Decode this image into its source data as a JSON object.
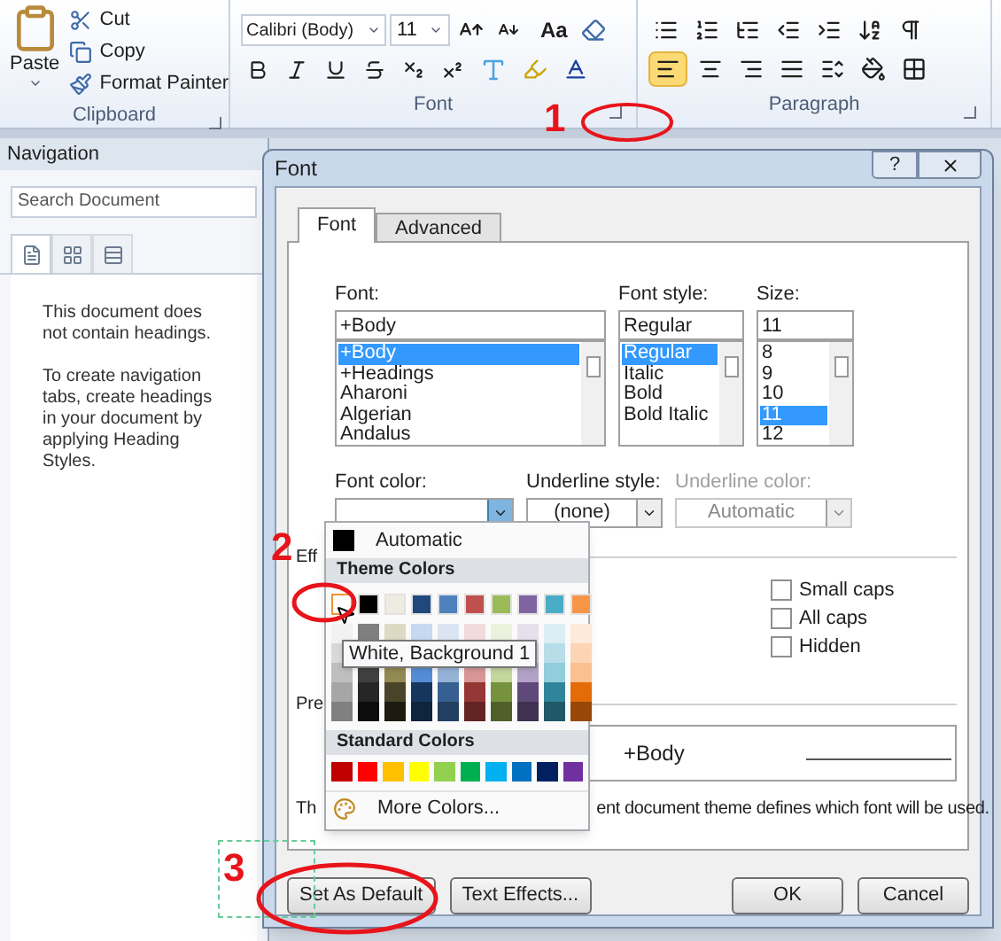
{
  "ribbon": {
    "clipboard": {
      "paste": "Paste",
      "items": [
        {
          "kind": "cut",
          "label": "Cut"
        },
        {
          "kind": "copy",
          "label": "Copy"
        },
        {
          "kind": "painter",
          "label": "Format Painter"
        }
      ],
      "label": "Clipboard"
    },
    "font": {
      "font_name": "Calibri (Body)",
      "font_size": "11",
      "case_label": "Aa",
      "label": "Font"
    },
    "paragraph": {
      "label": "Paragraph",
      "align": [
        {
          "kind": "left",
          "selected": true
        },
        {
          "kind": "center",
          "selected": false
        },
        {
          "kind": "right",
          "selected": false
        },
        {
          "kind": "justify",
          "selected": false
        }
      ]
    }
  },
  "navigation": {
    "title": "Navigation",
    "search": {
      "placeholder": "Search Document"
    },
    "tabs": [
      {
        "kind": "headings",
        "selected": true
      },
      {
        "kind": "pages",
        "selected": false
      },
      {
        "kind": "results",
        "selected": false
      }
    ],
    "messages": [
      "This document does not contain headings.",
      "To create navigation tabs, create headings in your document by applying Heading Styles."
    ]
  },
  "dialog": {
    "title": "Font",
    "help": "?",
    "tabs": [
      {
        "label": "Font",
        "selected": true
      },
      {
        "label": "Advanced",
        "selected": false
      }
    ],
    "font": {
      "label": "Font:",
      "value": "+Body",
      "items": [
        {
          "label": "+Body",
          "selected": true
        },
        {
          "label": "+Headings",
          "selected": false
        },
        {
          "label": "Aharoni",
          "selected": false
        },
        {
          "label": "Algerian",
          "selected": false
        },
        {
          "label": "Andalus",
          "selected": false
        }
      ]
    },
    "style": {
      "label": "Font style:",
      "value": "Regular",
      "items": [
        {
          "label": "Regular",
          "selected": true
        },
        {
          "label": "Italic",
          "selected": false
        },
        {
          "label": "Bold",
          "selected": false
        },
        {
          "label": "Bold Italic",
          "selected": false
        }
      ]
    },
    "size": {
      "label": "Size:",
      "value": "11",
      "items": [
        {
          "label": "8",
          "selected": false
        },
        {
          "label": "9",
          "selected": false
        },
        {
          "label": "10",
          "selected": false
        },
        {
          "label": "11",
          "selected": true
        },
        {
          "label": "12",
          "selected": false
        }
      ]
    },
    "font_color": {
      "label": "Font color:"
    },
    "underline_style": {
      "label": "Underline style:",
      "value": "(none)"
    },
    "underline_color": {
      "label": "Underline color:",
      "value": "Automatic",
      "disabled": true
    },
    "effects_label": "Eff",
    "effects": [
      {
        "label": "Small caps",
        "checked": false
      },
      {
        "label": "All caps",
        "checked": false
      },
      {
        "label": "Hidden",
        "checked": false
      }
    ],
    "preview_label": "Pre",
    "preview_text": "+Body",
    "description_start": "Th",
    "description_end": "ent document theme defines which font will be used.",
    "buttons": [
      {
        "label": "Set As Default"
      },
      {
        "label": "Text Effects..."
      },
      {
        "label": "OK"
      },
      {
        "label": "Cancel"
      }
    ]
  },
  "color_menu": {
    "automatic": "Automatic",
    "theme_header": "Theme Colors",
    "theme": [
      {
        "color": "#ffffff",
        "selected": true,
        "shades": [
          {
            "color": "#f2f2f2"
          },
          {
            "color": "#d9d9d9"
          },
          {
            "color": "#bfbfbf"
          },
          {
            "color": "#a6a6a6"
          },
          {
            "color": "#808080"
          }
        ]
      },
      {
        "color": "#000000",
        "selected": false,
        "shades": [
          {
            "color": "#7f7f7f"
          },
          {
            "color": "#404040"
          },
          {
            "color": "#262626"
          },
          {
            "color": "#0d0d0d"
          }
        ]
      },
      {
        "color": "#eeece1",
        "selected": false,
        "shades": [
          {
            "color": "#ddd9c3"
          },
          {
            "color": "#938953"
          },
          {
            "color": "#494429"
          },
          {
            "color": "#1d1b10"
          }
        ]
      },
      {
        "color": "#1f497d",
        "selected": false,
        "shades": [
          {
            "color": "#c6d9f0"
          },
          {
            "color": "#548dd4"
          },
          {
            "color": "#17365d"
          },
          {
            "color": "#0f243e"
          }
        ]
      },
      {
        "color": "#4f81bd",
        "selected": false,
        "shades": [
          {
            "color": "#dbe5f1"
          },
          {
            "color": "#95b3d7"
          },
          {
            "color": "#366092"
          },
          {
            "color": "#244061"
          }
        ]
      },
      {
        "color": "#c0504d",
        "selected": false,
        "shades": [
          {
            "color": "#f2dcdb"
          },
          {
            "color": "#d99694"
          },
          {
            "color": "#953734"
          },
          {
            "color": "#632423"
          }
        ]
      },
      {
        "color": "#9bbb59",
        "selected": false,
        "shades": [
          {
            "color": "#ebf1dd"
          },
          {
            "color": "#c3d69b"
          },
          {
            "color": "#76923c"
          },
          {
            "color": "#4f6128"
          }
        ]
      },
      {
        "color": "#8064a2",
        "selected": false,
        "shades": [
          {
            "color": "#e5e0ec"
          },
          {
            "color": "#ccc1d9"
          },
          {
            "color": "#b2a2c7"
          },
          {
            "color": "#5f497a"
          },
          {
            "color": "#3f3151"
          }
        ]
      },
      {
        "color": "#4bacc6",
        "selected": false,
        "shades": [
          {
            "color": "#dbeef3"
          },
          {
            "color": "#b7dde8"
          },
          {
            "color": "#92cddc"
          },
          {
            "color": "#31859b"
          },
          {
            "color": "#205867"
          }
        ]
      },
      {
        "color": "#f79646",
        "selected": false,
        "shades": [
          {
            "color": "#fdeada"
          },
          {
            "color": "#fbd5b5"
          },
          {
            "color": "#fac08f"
          },
          {
            "color": "#e36c09"
          },
          {
            "color": "#974806"
          }
        ]
      }
    ],
    "standard_header": "Standard Colors",
    "standard": [
      {
        "color": "#c00000"
      },
      {
        "color": "#ff0000"
      },
      {
        "color": "#ffc000"
      },
      {
        "color": "#ffff00"
      },
      {
        "color": "#92d050"
      },
      {
        "color": "#00b050"
      },
      {
        "color": "#00b0f0"
      },
      {
        "color": "#0070c0"
      },
      {
        "color": "#002060"
      },
      {
        "color": "#7030a0"
      }
    ],
    "more": "More Colors...",
    "tooltip": "White, Background 1"
  },
  "annotations": [
    {
      "label": "1"
    },
    {
      "label": "2"
    },
    {
      "label": "3"
    }
  ]
}
